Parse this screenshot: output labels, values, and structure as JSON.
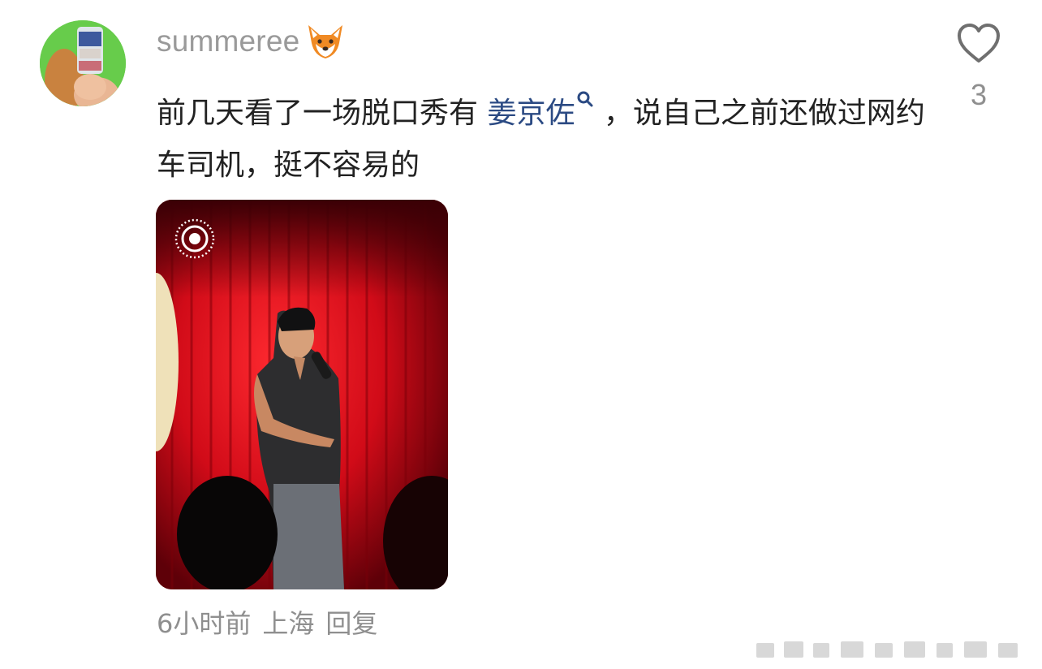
{
  "comment": {
    "username": "summeree",
    "text_before_mention": "前几天看了一场脱口秀有 ",
    "mention": "姜京佐",
    "text_after_mention": "，说自己之前还做过网约车司机，挺不容易的",
    "like_count": "3",
    "time": "6小时前",
    "location": "上海",
    "reply_label": "回复"
  },
  "icons": {
    "badge": "fox-emoji-icon",
    "mention": "search-icon",
    "like": "heart-outline-icon",
    "live_photo": "live-photo-icon"
  },
  "colors": {
    "username": "#9a9a9a",
    "mention": "#2b4a83",
    "meta": "#8f8f8f",
    "body_text": "#222222"
  }
}
